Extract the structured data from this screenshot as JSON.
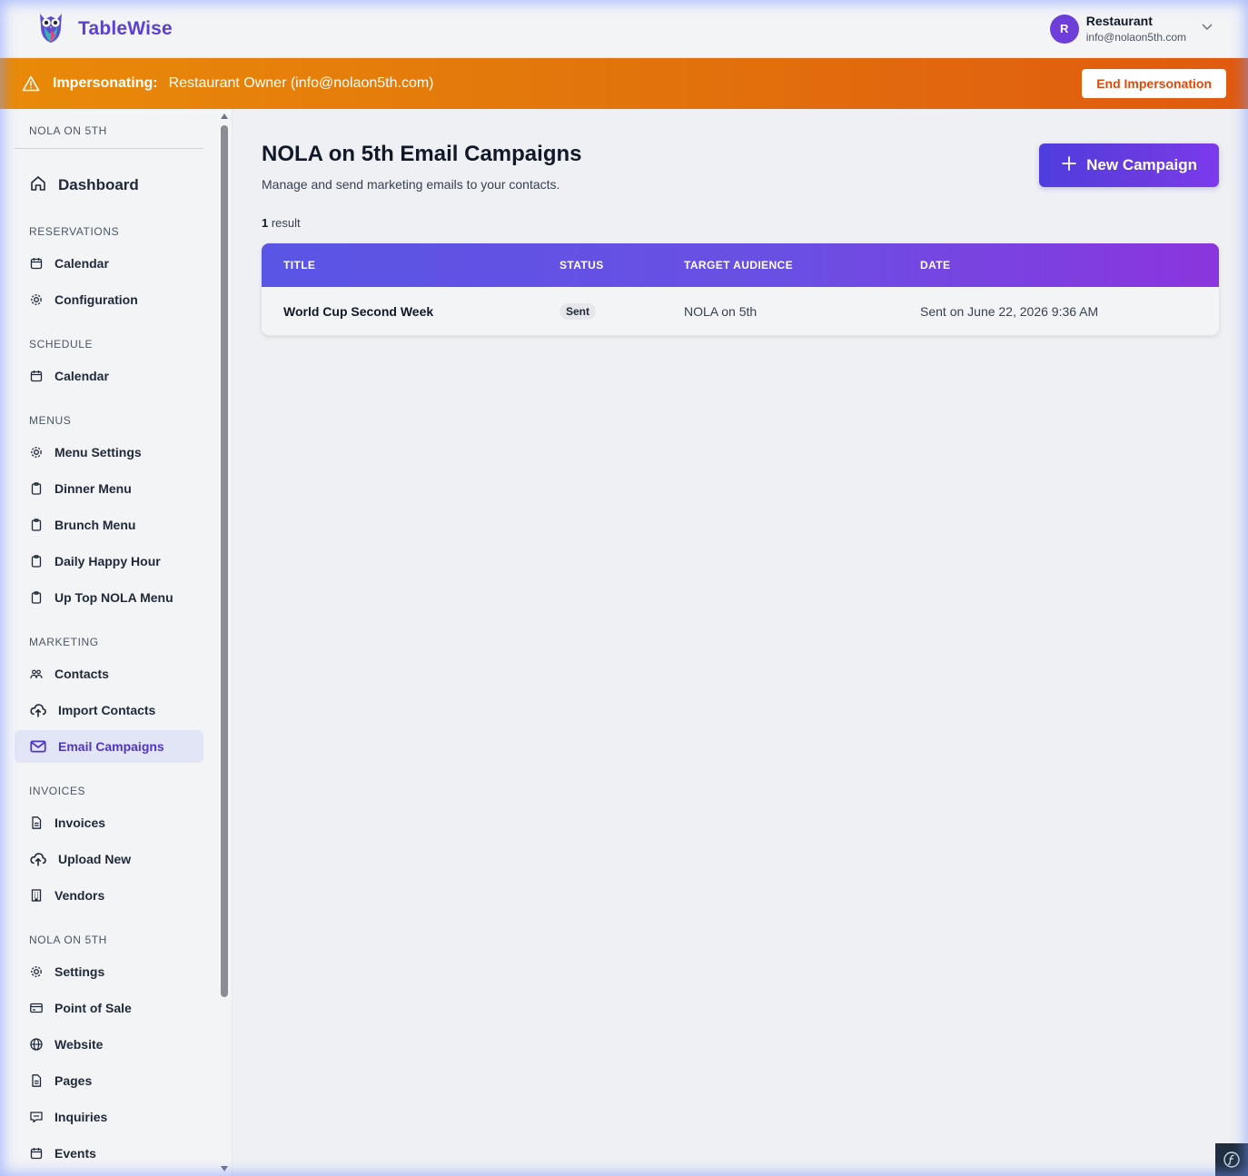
{
  "brand": {
    "name": "TableWise",
    "logo_icon": "owl-logo-icon"
  },
  "user": {
    "initial": "R",
    "name": "Restaurant",
    "email": "info@nolaon5th.com"
  },
  "banner": {
    "label": "Impersonating:",
    "text": "Restaurant Owner (info@nolaon5th.com)",
    "button": "End Impersonation"
  },
  "sidebar": {
    "top_label": "NOLA ON 5TH",
    "dashboard": "Dashboard",
    "sections": [
      {
        "title": "RESERVATIONS",
        "items": [
          {
            "label": "Calendar",
            "icon": "calendar-icon"
          },
          {
            "label": "Configuration",
            "icon": "gear-icon"
          }
        ]
      },
      {
        "title": "SCHEDULE",
        "items": [
          {
            "label": "Calendar",
            "icon": "calendar-icon"
          }
        ]
      },
      {
        "title": "MENUS",
        "items": [
          {
            "label": "Menu Settings",
            "icon": "gear-icon"
          },
          {
            "label": "Dinner Menu",
            "icon": "clipboard-icon"
          },
          {
            "label": "Brunch Menu",
            "icon": "clipboard-icon"
          },
          {
            "label": "Daily Happy Hour",
            "icon": "clipboard-icon"
          },
          {
            "label": "Up Top NOLA Menu",
            "icon": "clipboard-icon"
          }
        ]
      },
      {
        "title": "MARKETING",
        "items": [
          {
            "label": "Contacts",
            "icon": "users-icon"
          },
          {
            "label": "Import Contacts",
            "icon": "cloud-upload-icon"
          },
          {
            "label": "Email Campaigns",
            "icon": "envelope-icon",
            "active": true
          }
        ]
      },
      {
        "title": "INVOICES",
        "items": [
          {
            "label": "Invoices",
            "icon": "document-icon"
          },
          {
            "label": "Upload New",
            "icon": "cloud-upload-icon"
          },
          {
            "label": "Vendors",
            "icon": "building-icon"
          }
        ]
      },
      {
        "title": "NOLA ON 5TH",
        "items": [
          {
            "label": "Settings",
            "icon": "gear-icon"
          },
          {
            "label": "Point of Sale",
            "icon": "credit-card-icon"
          },
          {
            "label": "Website",
            "icon": "globe-icon"
          },
          {
            "label": "Pages",
            "icon": "document-icon"
          },
          {
            "label": "Inquiries",
            "icon": "chat-icon"
          },
          {
            "label": "Events",
            "icon": "calendar-icon"
          }
        ]
      }
    ]
  },
  "main": {
    "title": "NOLA on 5th Email Campaigns",
    "subtitle": "Manage and send marketing emails to your contacts.",
    "new_button": "New Campaign",
    "result_count": "1",
    "result_label": " result",
    "columns": [
      "TITLE",
      "STATUS",
      "TARGET AUDIENCE",
      "DATE"
    ],
    "rows": [
      {
        "title": "World Cup Second Week",
        "status": "Sent",
        "audience": "NOLA on 5th",
        "date": "Sent on June 22, 2026 9:36 AM"
      }
    ]
  },
  "colors": {
    "accent": "#5b3fd6",
    "banner_start": "#e98a09",
    "banner_end": "#e05a0f",
    "active_bg": "#e2e5f6"
  }
}
